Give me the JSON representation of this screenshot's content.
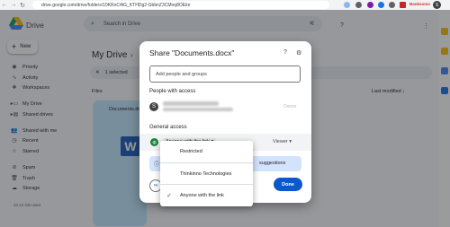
{
  "browser": {
    "url": "drive.google.com/drive/folders/10KRoC4tG_KTHDg2-GbbnZ3CMnq8OEkn",
    "profile_initial": "S",
    "extension_label": "Banksomo"
  },
  "drive": {
    "app_name": "Drive",
    "search_placeholder": "Search in Drive",
    "new_label": "New",
    "sidebar": [
      {
        "label": "Priority",
        "icon": "check-circle-icon"
      },
      {
        "label": "Activity",
        "icon": "pulse-icon"
      },
      {
        "label": "Workspaces",
        "icon": "workspaces-icon"
      },
      {
        "label": "My Drive",
        "icon": "drive-icon"
      },
      {
        "label": "Shared drives",
        "icon": "shared-drives-icon"
      },
      {
        "label": "Shared with me",
        "icon": "people-icon"
      },
      {
        "label": "Recent",
        "icon": "clock-icon"
      },
      {
        "label": "Starred",
        "icon": "star-icon"
      },
      {
        "label": "Spam",
        "icon": "spam-icon"
      },
      {
        "label": "Trash",
        "icon": "trash-icon"
      },
      {
        "label": "Storage",
        "icon": "cloud-icon"
      }
    ],
    "storage_text": "10.22 GB used",
    "page_title": "My Drive",
    "selection": {
      "count_text": "1 selected"
    },
    "files_label": "Files",
    "sort_label": "Last modified",
    "file_name": "Documents.docx",
    "file_icon_letter": "W"
  },
  "share_dialog": {
    "title": "Share \"Documents.docx\"",
    "add_placeholder": "Add people and groups",
    "people_label": "People with access",
    "owner_initial": "S",
    "owner_role": "Owner",
    "general_label": "General access",
    "access_value": "Anyone with the link",
    "role_value": "Viewer",
    "info_text": "suggestions",
    "done_label": "Done"
  },
  "access_menu": {
    "options": [
      "Restricted",
      "Thinkinno Technologies",
      "Anyone with the link"
    ],
    "selected_index": 2
  }
}
